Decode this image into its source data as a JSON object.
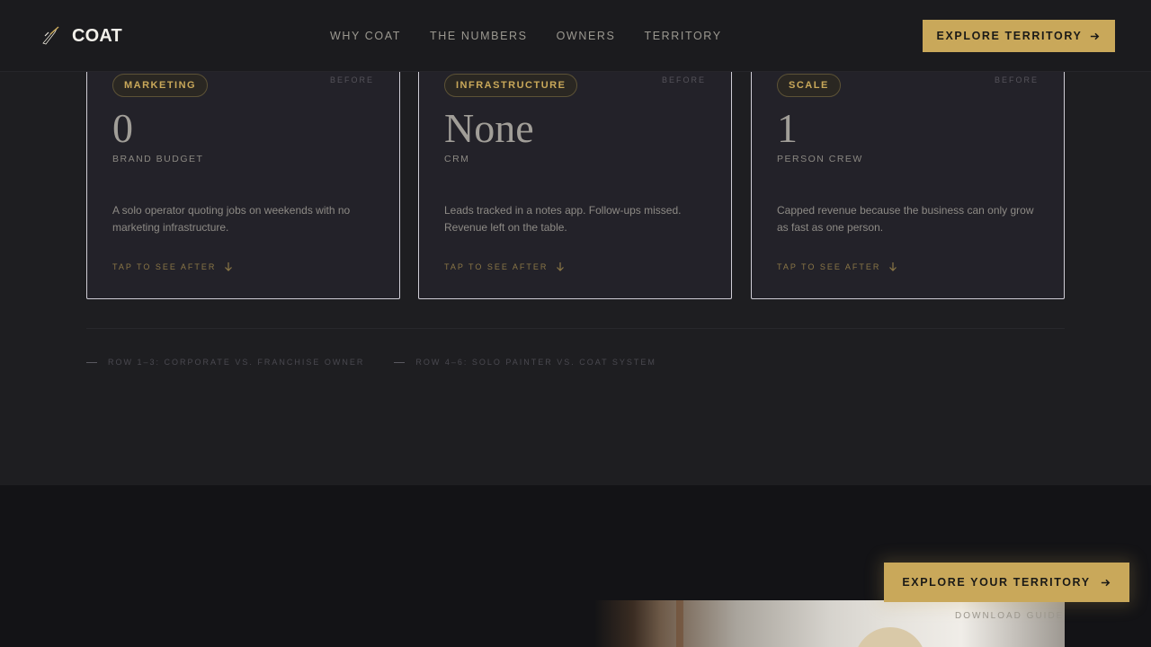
{
  "brand": {
    "name": "COAT",
    "accent_color": "#c9a85a",
    "logo_icon": "brush-stroke-icon"
  },
  "nav": {
    "items": [
      {
        "label": "WHY COAT"
      },
      {
        "label": "THE NUMBERS"
      },
      {
        "label": "OWNERS"
      },
      {
        "label": "TERRITORY"
      }
    ]
  },
  "header_cta": {
    "label": "EXPLORE TERRITORY",
    "icon": "arrow-right-icon"
  },
  "cards": [
    {
      "chip": "MARKETING",
      "state": "BEFORE",
      "value": "0",
      "metric": "BRAND BUDGET",
      "description": "A solo operator quoting jobs on weekends with no marketing infrastructure.",
      "tap_label": "TAP TO SEE AFTER"
    },
    {
      "chip": "INFRASTRUCTURE",
      "state": "BEFORE",
      "value": "None",
      "metric": "CRM",
      "description": "Leads tracked in a notes app. Follow-ups missed. Revenue left on the table.",
      "tap_label": "TAP TO SEE AFTER"
    },
    {
      "chip": "SCALE",
      "state": "BEFORE",
      "value": "1",
      "metric": "PERSON CREW",
      "description": "Capped revenue because the business can only grow as fast as one person.",
      "tap_label": "TAP TO SEE AFTER"
    }
  ],
  "legend": [
    {
      "label": "ROW 1–3: CORPORATE VS. FRANCHISE OWNER"
    },
    {
      "label": "ROW 4–6: SOLO PAINTER VS. COAT SYSTEM"
    }
  ],
  "floating_cta": {
    "label": "EXPLORE YOUR TERRITORY",
    "icon": "arrow-right-icon"
  },
  "download_label": "DOWNLOAD GUIDE"
}
